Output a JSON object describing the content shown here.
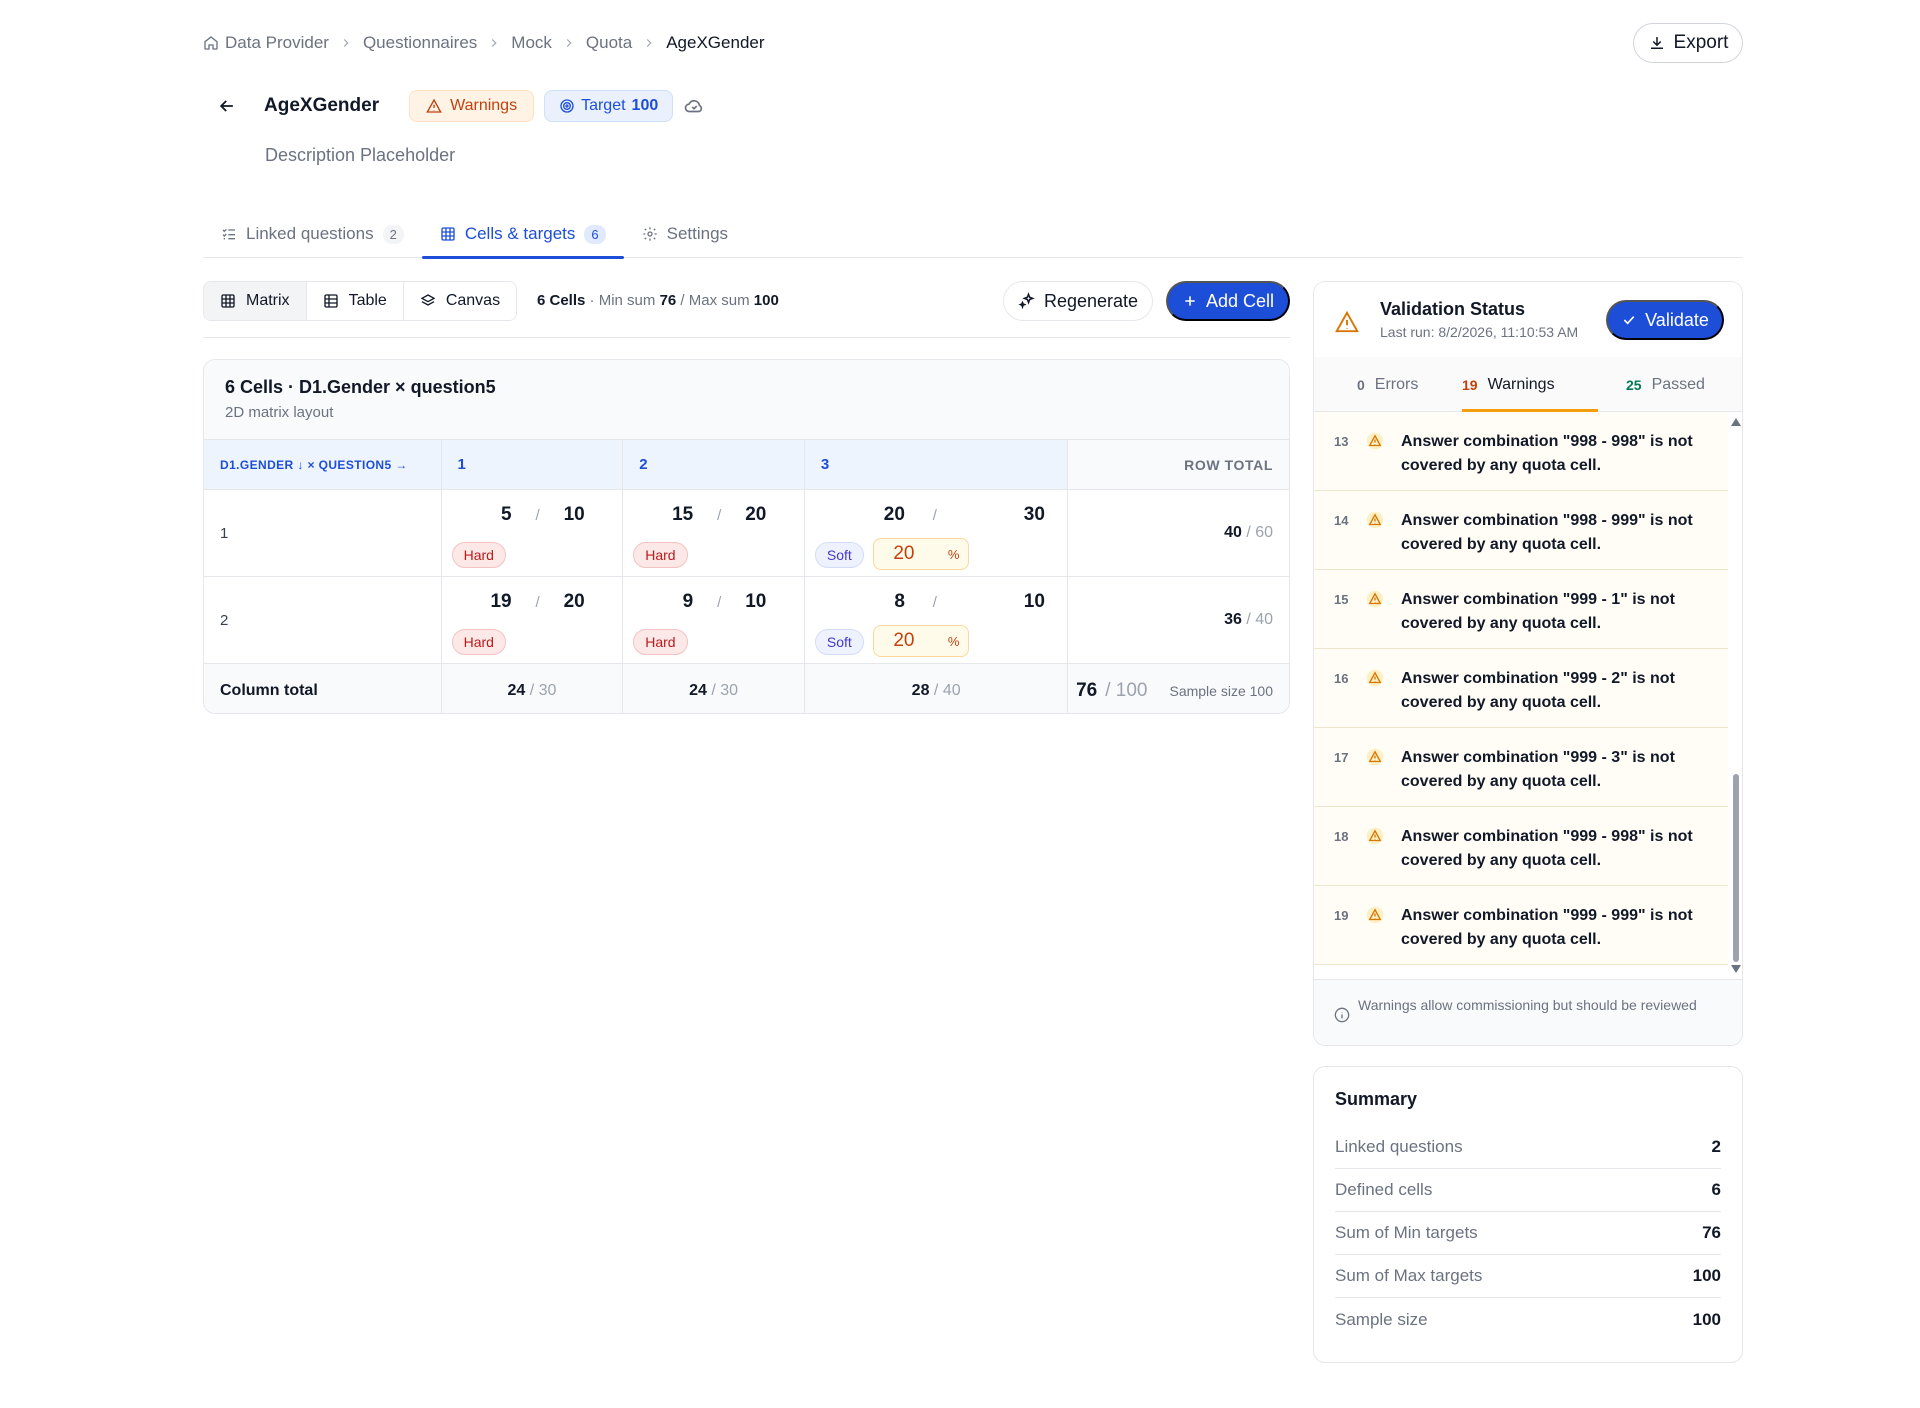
{
  "breadcrumb": [
    "Data Provider",
    "Questionnaires",
    "Mock",
    "Quota",
    "AgeXGender"
  ],
  "export_label": "Export",
  "page": {
    "title": "AgeXGender",
    "warnings_badge": "Warnings",
    "target_label": "Target",
    "target_value": "100",
    "description": "Description Placeholder"
  },
  "tabs": [
    {
      "label": "Linked questions",
      "count": "2"
    },
    {
      "label": "Cells & targets",
      "count": "6"
    },
    {
      "label": "Settings",
      "count": ""
    }
  ],
  "toolbar": {
    "views": [
      "Matrix",
      "Table",
      "Canvas"
    ],
    "cells_count": "6 Cells",
    "dot": " · ",
    "min_label": "Min sum ",
    "min_value": "76",
    "slash": " / ",
    "max_label": "Max sum ",
    "max_value": "100",
    "regenerate": "Regenerate",
    "add_cell": "Add Cell"
  },
  "matrix": {
    "title": "6 Cells · D1.Gender × question5",
    "subtitle": "2D matrix layout",
    "axis_header": "D1.GENDER ↓ × QUESTION5 →",
    "columns": [
      "1",
      "2",
      "3"
    ],
    "row_total_header": "ROW TOTAL",
    "rows": [
      {
        "label": "1",
        "cells": [
          {
            "min": "5",
            "max": "10",
            "type": "Hard"
          },
          {
            "min": "15",
            "max": "20",
            "type": "Hard"
          },
          {
            "min": "20",
            "max": "30",
            "type": "Soft",
            "pct": "20",
            "pct_sign": "%"
          }
        ],
        "total_min": "40",
        "total_max": "/ 60"
      },
      {
        "label": "2",
        "cells": [
          {
            "min": "19",
            "max": "20",
            "type": "Hard"
          },
          {
            "min": "9",
            "max": "10",
            "type": "Hard"
          },
          {
            "min": "8",
            "max": "10",
            "type": "Soft",
            "pct": "20",
            "pct_sign": "%"
          }
        ],
        "total_min": "36",
        "total_max": "/ 40"
      }
    ],
    "column_total_label": "Column total",
    "column_totals": [
      {
        "min": "24",
        "max": "/ 30"
      },
      {
        "min": "24",
        "max": "/ 30"
      },
      {
        "min": "28",
        "max": "/ 40"
      }
    ],
    "grand_total_min": "76",
    "grand_total_max": "/ 100",
    "sample_size_label": "Sample size 100"
  },
  "validation": {
    "title": "Validation Status",
    "last_run": "Last run: 8/2/2026, 11:10:53 AM",
    "validate_label": "Validate",
    "tabs": [
      {
        "count": "0",
        "label": "Errors"
      },
      {
        "count": "19",
        "label": "Warnings"
      },
      {
        "count": "25",
        "label": "Passed"
      }
    ],
    "warnings": [
      {
        "index": "13",
        "message": "Answer combination \"998 - 998\" is not covered by any quota cell."
      },
      {
        "index": "14",
        "message": "Answer combination \"998 - 999\" is not covered by any quota cell."
      },
      {
        "index": "15",
        "message": "Answer combination \"999 - 1\" is not covered by any quota cell."
      },
      {
        "index": "16",
        "message": "Answer combination \"999 - 2\" is not covered by any quota cell."
      },
      {
        "index": "17",
        "message": "Answer combination \"999 - 3\" is not covered by any quota cell."
      },
      {
        "index": "18",
        "message": "Answer combination \"999 - 998\" is not covered by any quota cell."
      },
      {
        "index": "19",
        "message": "Answer combination \"999 - 999\" is not covered by any quota cell."
      }
    ],
    "footer_note": "Warnings allow commissioning but should be reviewed"
  },
  "summary": {
    "title": "Summary",
    "rows": [
      {
        "label": "Linked questions",
        "value": "2"
      },
      {
        "label": "Defined cells",
        "value": "6"
      },
      {
        "label": "Sum of Min targets",
        "value": "76"
      },
      {
        "label": "Sum of Max targets",
        "value": "100"
      },
      {
        "label": "Sample size",
        "value": "100"
      }
    ]
  },
  "colors": {
    "primary": "#1d4ed8",
    "warning": "#c2410c",
    "success": "#047857",
    "hard": "#b91c1c",
    "soft": "#4338ca"
  }
}
